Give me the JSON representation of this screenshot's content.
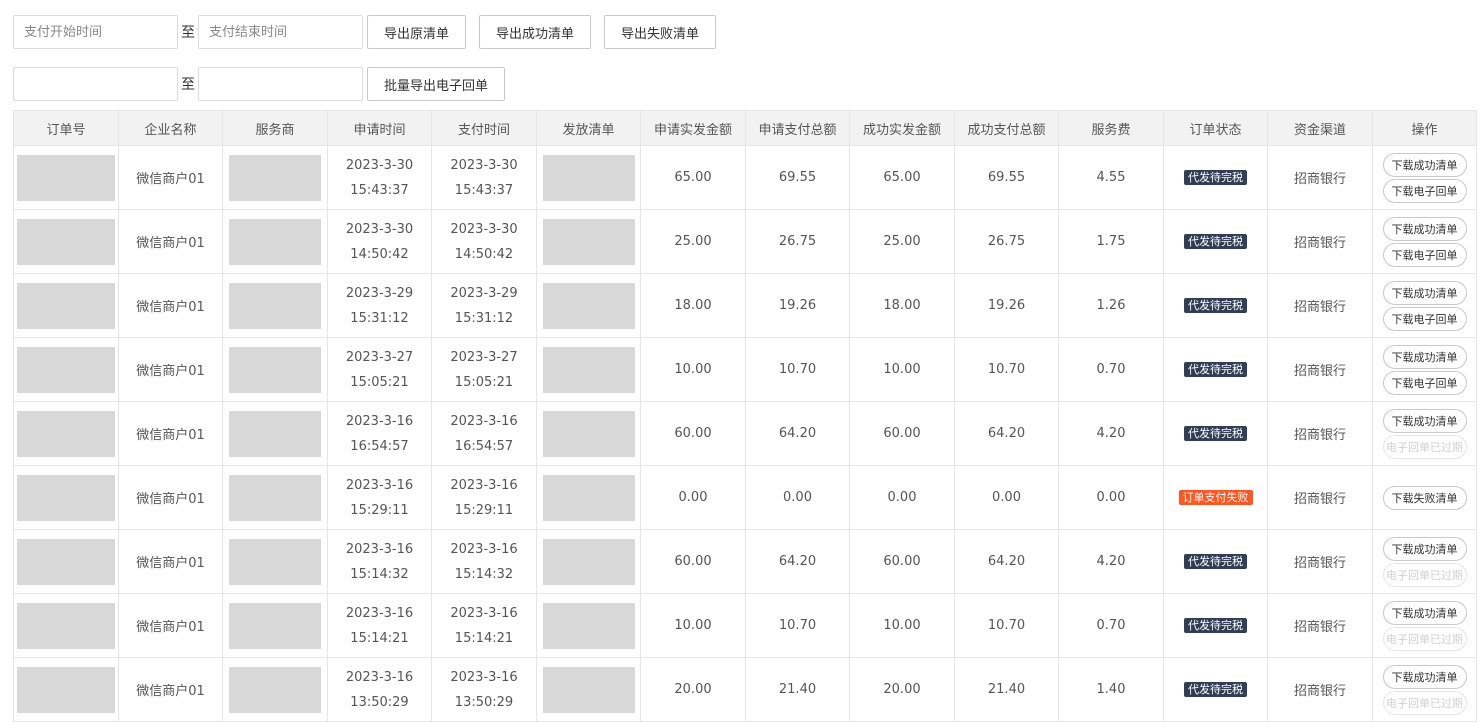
{
  "filters": {
    "pay_start_placeholder": "支付开始时间",
    "pay_end_placeholder": "支付结束时间",
    "to_label": "至",
    "export_original": "导出原清单",
    "export_success": "导出成功清单",
    "export_fail": "导出失败清单",
    "range_start_value": "",
    "range_end_value": "",
    "to_label_2": "至",
    "batch_export_receipt": "批量导出电子回单"
  },
  "table": {
    "headers": [
      "订单号",
      "企业名称",
      "服务商",
      "申请时间",
      "支付时间",
      "发放清单",
      "申请实发金额",
      "申请支付总额",
      "成功实发金额",
      "成功支付总额",
      "服务费",
      "订单状态",
      "资金渠道",
      "操作"
    ],
    "rows": [
      {
        "company": "微信商户01",
        "apply_date": "2023-3-30",
        "apply_time": "15:43:37",
        "pay_date": "2023-3-30",
        "pay_time": "15:43:37",
        "apply_actual": "65.00",
        "apply_total": "69.55",
        "success_actual": "65.00",
        "success_total": "69.55",
        "fee": "4.55",
        "status": "代发待完税",
        "status_type": "ok",
        "channel": "招商银行",
        "op1": "下载成功清单",
        "op1_disabled": false,
        "op2": "下载电子回单",
        "op2_disabled": false
      },
      {
        "company": "微信商户01",
        "apply_date": "2023-3-30",
        "apply_time": "14:50:42",
        "pay_date": "2023-3-30",
        "pay_time": "14:50:42",
        "apply_actual": "25.00",
        "apply_total": "26.75",
        "success_actual": "25.00",
        "success_total": "26.75",
        "fee": "1.75",
        "status": "代发待完税",
        "status_type": "ok",
        "channel": "招商银行",
        "op1": "下载成功清单",
        "op1_disabled": false,
        "op2": "下载电子回单",
        "op2_disabled": false
      },
      {
        "company": "微信商户01",
        "apply_date": "2023-3-29",
        "apply_time": "15:31:12",
        "pay_date": "2023-3-29",
        "pay_time": "15:31:12",
        "apply_actual": "18.00",
        "apply_total": "19.26",
        "success_actual": "18.00",
        "success_total": "19.26",
        "fee": "1.26",
        "status": "代发待完税",
        "status_type": "ok",
        "channel": "招商银行",
        "op1": "下载成功清单",
        "op1_disabled": false,
        "op2": "下载电子回单",
        "op2_disabled": false
      },
      {
        "company": "微信商户01",
        "apply_date": "2023-3-27",
        "apply_time": "15:05:21",
        "pay_date": "2023-3-27",
        "pay_time": "15:05:21",
        "apply_actual": "10.00",
        "apply_total": "10.70",
        "success_actual": "10.00",
        "success_total": "10.70",
        "fee": "0.70",
        "status": "代发待完税",
        "status_type": "ok",
        "channel": "招商银行",
        "op1": "下载成功清单",
        "op1_disabled": false,
        "op2": "下载电子回单",
        "op2_disabled": false
      },
      {
        "company": "微信商户01",
        "apply_date": "2023-3-16",
        "apply_time": "16:54:57",
        "pay_date": "2023-3-16",
        "pay_time": "16:54:57",
        "apply_actual": "60.00",
        "apply_total": "64.20",
        "success_actual": "60.00",
        "success_total": "64.20",
        "fee": "4.20",
        "status": "代发待完税",
        "status_type": "ok",
        "channel": "招商银行",
        "op1": "下载成功清单",
        "op1_disabled": false,
        "op2": "电子回单已过期",
        "op2_disabled": true
      },
      {
        "company": "微信商户01",
        "apply_date": "2023-3-16",
        "apply_time": "15:29:11",
        "pay_date": "2023-3-16",
        "pay_time": "15:29:11",
        "apply_actual": "0.00",
        "apply_total": "0.00",
        "success_actual": "0.00",
        "success_total": "0.00",
        "fee": "0.00",
        "status": "订单支付失败",
        "status_type": "fail",
        "channel": "招商银行",
        "op1": "下载失败清单",
        "op1_disabled": false,
        "op2": "",
        "op2_disabled": false
      },
      {
        "company": "微信商户01",
        "apply_date": "2023-3-16",
        "apply_time": "15:14:32",
        "pay_date": "2023-3-16",
        "pay_time": "15:14:32",
        "apply_actual": "60.00",
        "apply_total": "64.20",
        "success_actual": "60.00",
        "success_total": "64.20",
        "fee": "4.20",
        "status": "代发待完税",
        "status_type": "ok",
        "channel": "招商银行",
        "op1": "下载成功清单",
        "op1_disabled": false,
        "op2": "电子回单已过期",
        "op2_disabled": true
      },
      {
        "company": "微信商户01",
        "apply_date": "2023-3-16",
        "apply_time": "15:14:21",
        "pay_date": "2023-3-16",
        "pay_time": "15:14:21",
        "apply_actual": "10.00",
        "apply_total": "10.70",
        "success_actual": "10.00",
        "success_total": "10.70",
        "fee": "0.70",
        "status": "代发待完税",
        "status_type": "ok",
        "channel": "招商银行",
        "op1": "下载成功清单",
        "op1_disabled": false,
        "op2": "电子回单已过期",
        "op2_disabled": true
      },
      {
        "company": "微信商户01",
        "apply_date": "2023-3-16",
        "apply_time": "13:50:29",
        "pay_date": "2023-3-16",
        "pay_time": "13:50:29",
        "apply_actual": "20.00",
        "apply_total": "21.40",
        "success_actual": "20.00",
        "success_total": "21.40",
        "fee": "1.40",
        "status": "代发待完税",
        "status_type": "ok",
        "channel": "招商银行",
        "op1": "下载成功清单",
        "op1_disabled": false,
        "op2": "电子回单已过期",
        "op2_disabled": true
      }
    ]
  },
  "colors": {
    "status_ok": "#2f4056",
    "status_fail": "#ff5722",
    "header_bg": "#f2f2f2",
    "redacted": "#d8d8d8"
  }
}
